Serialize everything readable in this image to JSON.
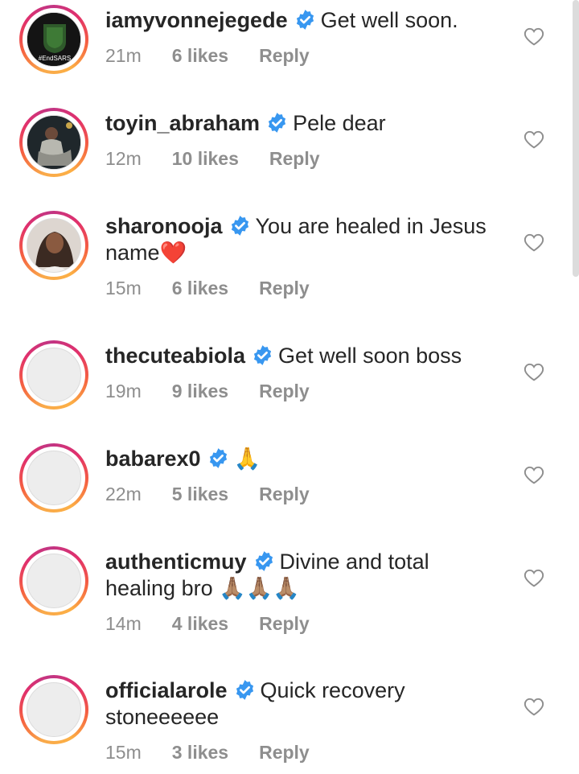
{
  "comments": [
    {
      "username": "iamyvonnejegede",
      "text": "Get well soon.",
      "continuation": "",
      "time": "21m",
      "likes": "6 likes",
      "reply": "Reply",
      "avatar": "endsars-fist",
      "avatar_text": "#EndSARS"
    },
    {
      "username": "toyin_abraham",
      "text": "Pele dear",
      "continuation": "",
      "time": "12m",
      "likes": "10 likes",
      "reply": "Reply",
      "avatar": "portrait-woman"
    },
    {
      "username": "sharonooja",
      "text": "You are healed in Jesus",
      "continuation": "name❤️",
      "time": "15m",
      "likes": "6 likes",
      "reply": "Reply",
      "avatar": "portrait-woman-2"
    },
    {
      "username": "thecuteabiola",
      "text": "Get well soon boss",
      "continuation": "",
      "time": "19m",
      "likes": "9 likes",
      "reply": "Reply",
      "avatar": "blank"
    },
    {
      "username": "babarex0",
      "text": "🙏",
      "continuation": "",
      "time": "22m",
      "likes": "5 likes",
      "reply": "Reply",
      "avatar": "blank"
    },
    {
      "username": "authenticmuy",
      "text": "Divine and total",
      "continuation": "healing bro 🙏🏽🙏🏽🙏🏽",
      "time": "14m",
      "likes": "4 likes",
      "reply": "Reply",
      "avatar": "blank"
    },
    {
      "username": "officialarole",
      "text": "Quick recovery",
      "continuation": "stoneeeeee",
      "time": "15m",
      "likes": "3 likes",
      "reply": "Reply",
      "avatar": "blank"
    }
  ],
  "colors": {
    "verified": "#3897f0",
    "meta": "#8e8e8e",
    "text": "#262626"
  },
  "icons": {
    "verified": "verified-badge-icon",
    "like": "heart-outline-icon"
  }
}
